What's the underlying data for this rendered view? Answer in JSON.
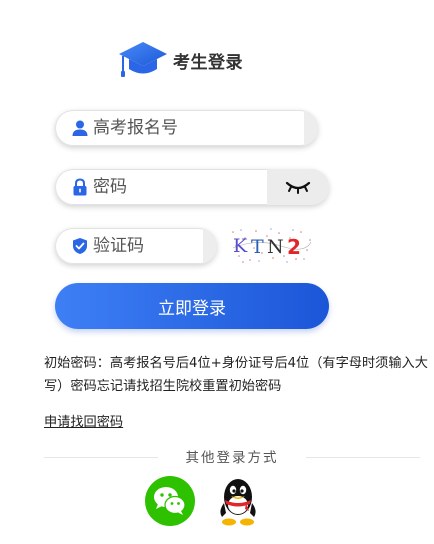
{
  "header": {
    "title": "考生登录",
    "icon": "graduation-cap-icon",
    "accent": "#2a66e6"
  },
  "form": {
    "exam_number": {
      "placeholder": "高考报名号",
      "value": "",
      "icon": "user-icon"
    },
    "password": {
      "placeholder": "密码",
      "value": "",
      "icon": "lock-icon",
      "toggle_icon": "eye-closed-icon"
    },
    "captcha": {
      "placeholder": "验证码",
      "value": "",
      "icon": "shield-check-icon",
      "image_text": "KTN2"
    },
    "login_label": "立即登录"
  },
  "tip": "初始密码：高考报名号后4位+身份证号后4位（有字母时须输入大写）密码忘记请找招生院校重置初始密码",
  "retrieve_link": "申请找回密码",
  "other_login": {
    "label": "其他登录方式",
    "options": [
      {
        "name": "wechat",
        "icon": "wechat-icon",
        "color": "#2dc100"
      },
      {
        "name": "qq",
        "icon": "qq-icon",
        "color": "#000000"
      }
    ]
  }
}
